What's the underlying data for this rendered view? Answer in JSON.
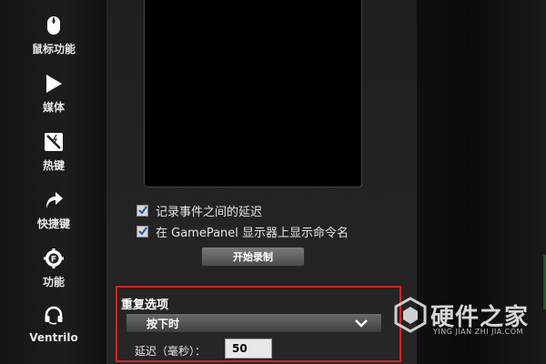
{
  "sidebar": {
    "items": [
      {
        "label": "鼠标功能",
        "icon": "mouse-icon"
      },
      {
        "label": "媒体",
        "icon": "play-icon"
      },
      {
        "label": "热键",
        "icon": "hotkey-icon"
      },
      {
        "label": "快捷键",
        "icon": "shortcut-arrow-icon"
      },
      {
        "label": "功能",
        "icon": "function-gear-icon"
      },
      {
        "label": "Ventrilo",
        "icon": "headset-icon"
      }
    ]
  },
  "main": {
    "options": [
      {
        "label": "记录事件之间的延迟",
        "checked": true
      },
      {
        "label": "在 GamePanel 显示器上显示命令名",
        "checked": true
      }
    ],
    "start_button": "开始录制",
    "repeat": {
      "title": "重复选项",
      "selected": "按下时",
      "delay_label": "延迟（毫秒）：",
      "delay_value": "50"
    }
  },
  "watermark": {
    "text": "硬件之家",
    "sub": "YING JIAN ZHI JIA.COM"
  },
  "colors": {
    "highlight": "#e02020",
    "checkbox_check": "#1a5fb4"
  }
}
